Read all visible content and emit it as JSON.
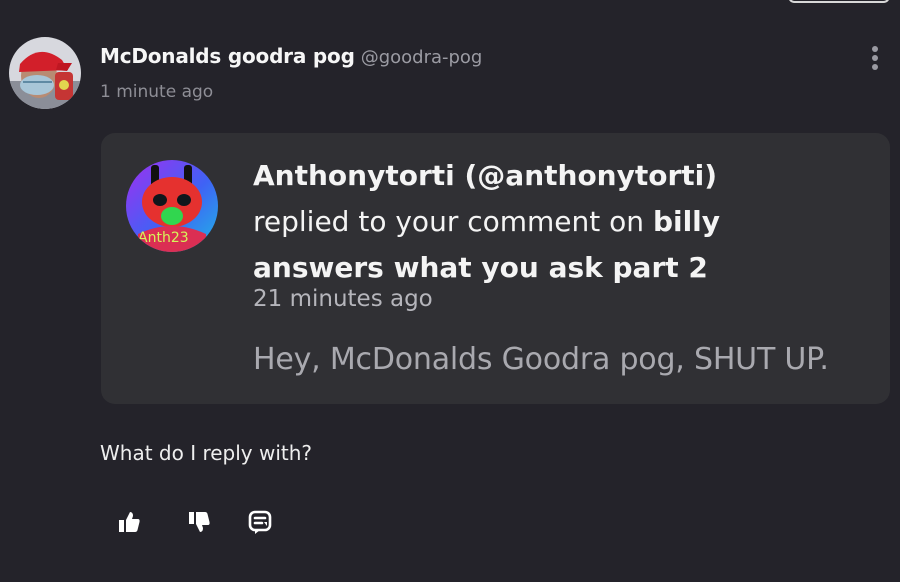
{
  "post": {
    "author_name": "McDonalds goodra pog",
    "author_handle": "@goodra-pog",
    "time": "1 minute ago",
    "body": "What do I reply with?"
  },
  "notification": {
    "user": "Anthonytorti (@anthonytorti)",
    "action": "replied to your comment on",
    "target": "billy answers what you ask part 2",
    "time": "21 minutes ago",
    "message": "Hey, McDonalds Goodra pog, SHUT UP.",
    "avatar_watermark": "Anth23"
  },
  "actions": {
    "like_icon": "thumbs-up-icon",
    "dislike_icon": "thumbs-down-icon",
    "reply_icon": "reply-icon"
  },
  "colors": {
    "background": "#24232a",
    "card": "#303034",
    "text": "#f4f4f4",
    "muted": "#9b9ba3"
  }
}
